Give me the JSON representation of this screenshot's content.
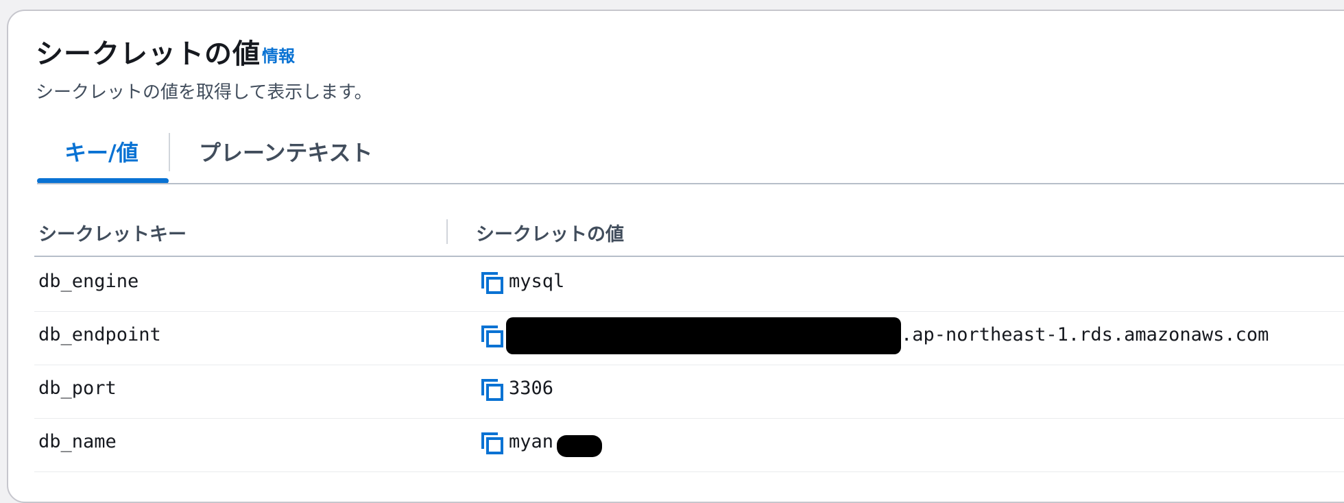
{
  "header": {
    "title": "シークレットの値",
    "info_link": "情報",
    "description": "シークレットの値を取得して表示します。"
  },
  "tabs": [
    {
      "label": "キー/値",
      "active": true
    },
    {
      "label": "プレーンテキスト",
      "active": false
    }
  ],
  "table": {
    "columns": [
      "シークレットキー",
      "シークレットの値"
    ],
    "rows": [
      {
        "key": "db_engine",
        "value": "mysql",
        "redacted": false
      },
      {
        "key": "db_endpoint",
        "value": ".ap-northeast-1.rds.amazonaws.com",
        "redacted": true
      },
      {
        "key": "db_port",
        "value": "3306",
        "redacted": false
      },
      {
        "key": "db_name",
        "value": "myan",
        "redacted": true
      }
    ]
  },
  "icons": {
    "copy": "copy-icon"
  },
  "colors": {
    "accent": "#0972d3",
    "text": "#16191f",
    "muted": "#414d5c",
    "redaction": "#000000"
  }
}
